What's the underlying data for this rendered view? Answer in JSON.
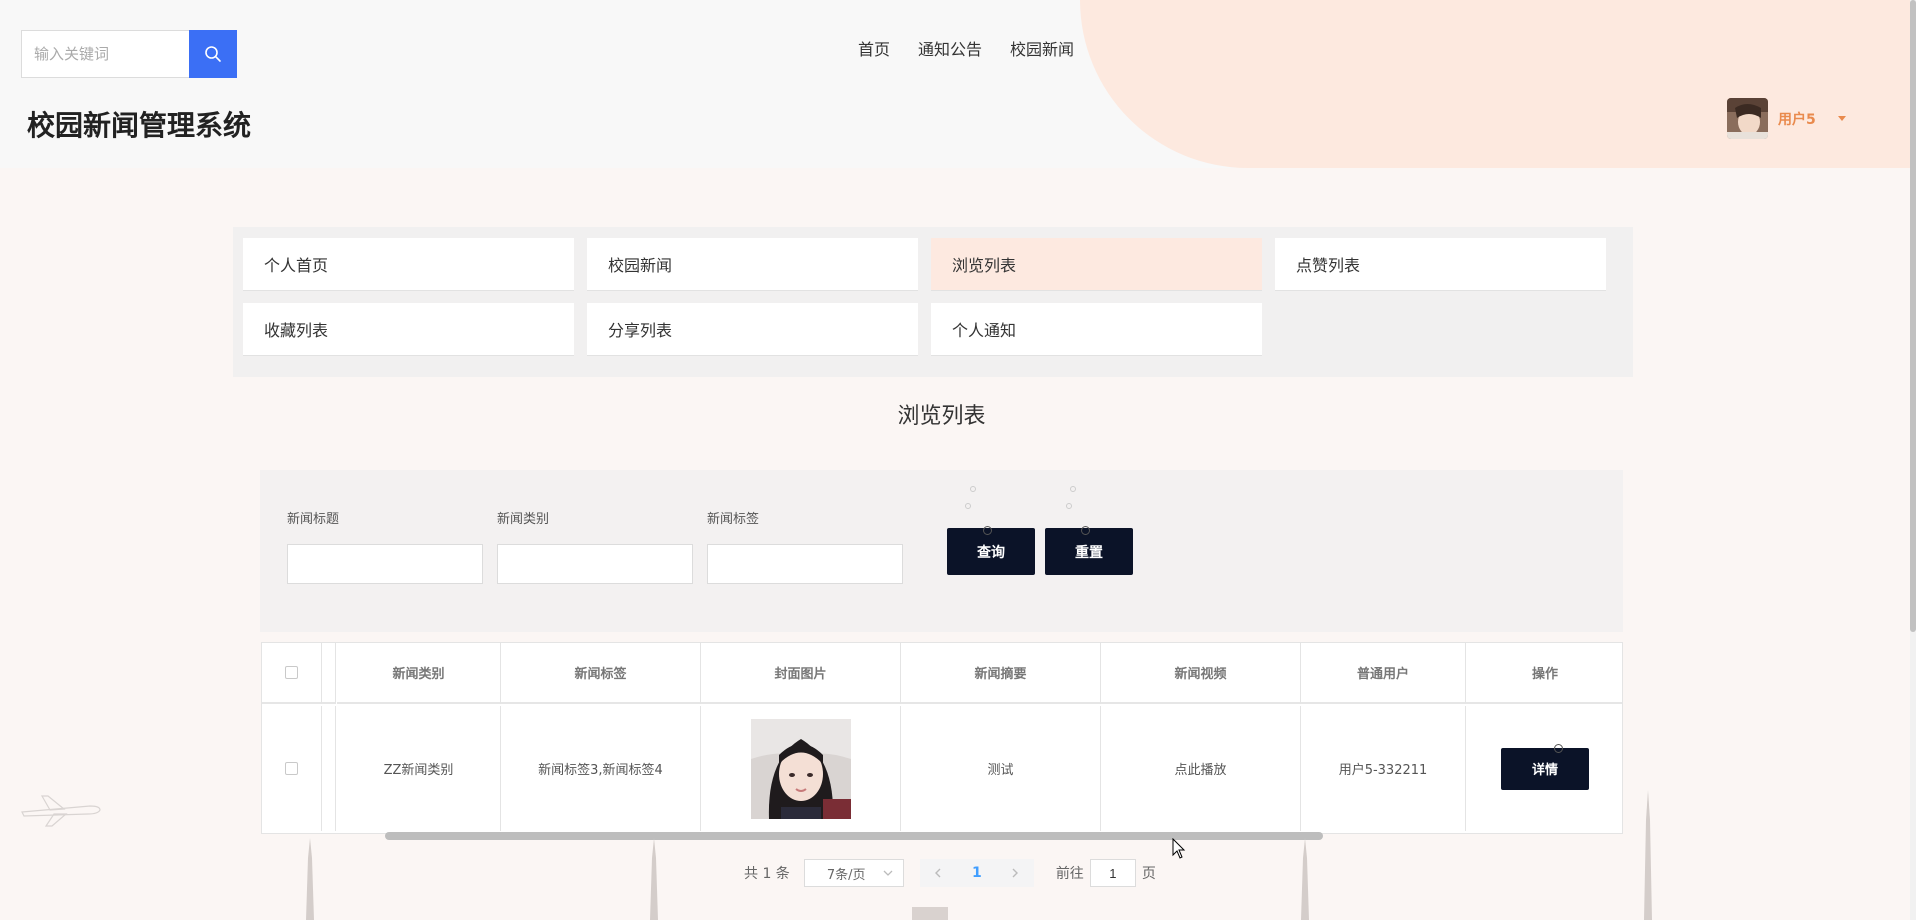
{
  "search": {
    "placeholder": "输入关键词"
  },
  "nav": {
    "items": [
      "首页",
      "通知公告",
      "校园新闻"
    ]
  },
  "site_title": "校园新闻管理系统",
  "user": {
    "name": "用户5"
  },
  "menu": {
    "items": [
      "个人首页",
      "校园新闻",
      "浏览列表",
      "点赞列表",
      "收藏列表",
      "分享列表",
      "个人通知"
    ],
    "active": "浏览列表"
  },
  "page_title": "浏览列表",
  "filters": {
    "title_label": "新闻标题",
    "category_label": "新闻类别",
    "tag_label": "新闻标签",
    "query_button": "查询",
    "reset_button": "重置"
  },
  "table": {
    "headers": [
      "新闻类别",
      "新闻标签",
      "封面图片",
      "新闻摘要",
      "新闻视频",
      "普通用户",
      "操作"
    ],
    "rows": [
      {
        "category": "ZZ新闻类别",
        "tags": "新闻标签3,新闻标签4",
        "summary": "测试",
        "video": "点此播放",
        "user": "用户5-332211",
        "action": "详情"
      }
    ]
  },
  "pagination": {
    "total": "共 1 条",
    "page_size": "7条/页",
    "current_page": "1",
    "goto_prefix": "前往",
    "goto_value": "1",
    "goto_suffix": "页"
  },
  "colors": {
    "accent_blue": "#3b6ff5",
    "dark_button": "#0b1328",
    "user_orange": "#e98a4d",
    "active_menu": "#fde9e0",
    "page_link": "#409eff"
  },
  "icons": [
    "search-icon",
    "caret-down-icon",
    "chevron-left-icon",
    "chevron-right-icon",
    "chevron-down-icon"
  ]
}
